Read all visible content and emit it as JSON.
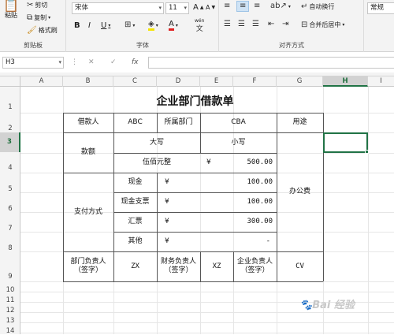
{
  "ribbon": {
    "clipboard": {
      "paste": "粘贴",
      "cut": "剪切",
      "copy": "复制",
      "format_painter": "格式刷",
      "label": "剪贴板"
    },
    "font": {
      "name": "宋体",
      "size": "11",
      "grow": "A",
      "shrink": "A",
      "bold": "B",
      "italic": "I",
      "underline": "U",
      "wen": "wén",
      "fill": "A",
      "label": "字体"
    },
    "align": {
      "wrap": "自动换行",
      "merge": "合并后居中",
      "label": "对齐方式"
    },
    "number": {
      "format": "常规"
    }
  },
  "formula_bar": {
    "name_box": "H3",
    "fx": "fx",
    "value": ""
  },
  "columns": [
    "A",
    "B",
    "C",
    "D",
    "E",
    "F",
    "G",
    "H",
    "I"
  ],
  "rows": [
    "1",
    "2",
    "3",
    "4",
    "5",
    "6",
    "7",
    "8",
    "9",
    "10",
    "11",
    "12",
    "13",
    "14"
  ],
  "sheet": {
    "title": "企业部门借款单",
    "borrower_label": "借款人",
    "borrower": "ABC",
    "dept_label": "所属部门",
    "dept": "CBA",
    "purpose_label": "用途",
    "purpose": "办公费",
    "amount_label": "款额",
    "upper_label": "大写",
    "lower_label": "小写",
    "upper_value": "伍佰元整",
    "lower_currency": "¥",
    "lower_value": "500.00",
    "pay_label": "支付方式",
    "pay_rows": [
      {
        "label": "现金",
        "currency": "¥",
        "value": "100.00"
      },
      {
        "label": "现金支票",
        "currency": "¥",
        "value": "100.00"
      },
      {
        "label": "汇票",
        "currency": "¥",
        "value": "300.00"
      },
      {
        "label": "其他",
        "currency": "¥",
        "value": "-"
      }
    ],
    "dept_head_label": "部门负责人\n（签字）",
    "dept_head": "ZX",
    "fin_head_label": "财务负责人\n（签字）",
    "fin_head": "XZ",
    "corp_head_label": "企业负责人\n（签字）",
    "corp_head": "CV"
  },
  "watermark": "Bai 经验"
}
